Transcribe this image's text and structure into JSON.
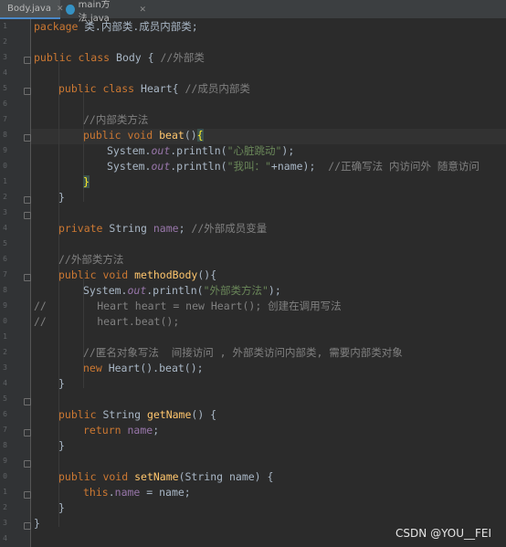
{
  "tabs": [
    {
      "label": "Body.java",
      "active": true,
      "icon": "java-class-icon"
    },
    {
      "label": "main方法.java",
      "active": false,
      "icon": "java-class-icon"
    }
  ],
  "gutter": {
    "numbers": [
      "1",
      "2",
      "3",
      "4",
      "5",
      "6",
      "7",
      "8",
      "9",
      "0",
      "1",
      "2",
      "3",
      "4",
      "5",
      "6",
      "7",
      "8",
      "9",
      "0",
      "1",
      "2",
      "3",
      "4",
      "5",
      "6",
      "7",
      "8",
      "9",
      "0",
      "1",
      "2",
      "3",
      "4"
    ]
  },
  "code": {
    "package_kw": "package",
    "package_name": " 类.内部类.成员内部类;",
    "l3": {
      "kw": "public class",
      "rest": " Body { ",
      "cm": "//外部类"
    },
    "l5": {
      "kw": "public class",
      "rest": " Heart{ ",
      "cm": "//成员内部类"
    },
    "l7": {
      "cm": "//内部类方法"
    },
    "l8": {
      "kw": "public void",
      "sp": " ",
      "fn": "beat",
      "p1": "()",
      "brace": "{"
    },
    "l9": {
      "a": "System.",
      "f": "out",
      "b": ".println(",
      "s": "\"心脏跳动\"",
      "c": ");"
    },
    "l10": {
      "a": "System.",
      "f": "out",
      "b": ".println(",
      "s": "\"我叫：\"",
      "c": "+name);  ",
      "cm": "//正确写法 内访问外 随意访问"
    },
    "l11": {
      "brace": "}"
    },
    "l12": {
      "brace": "}"
    },
    "l14": {
      "kw": "private",
      "rest": " String ",
      "fld": "name",
      "semi": "; ",
      "cm": "//外部成员变量"
    },
    "l16": {
      "cm": "//外部类方法"
    },
    "l17": {
      "kw": "public void",
      "sp": " ",
      "fn": "methodBody",
      "p1": "(){"
    },
    "l18": {
      "a": "System.",
      "f": "out",
      "b": ".println(",
      "s": "\"外部类方法\"",
      "c": ");"
    },
    "l19": {
      "cm": "//        Heart heart = new Heart(); 创建在调用写法"
    },
    "l20": {
      "cm": "//        heart.beat();"
    },
    "l22": {
      "cm": "//匿名对象写法  间接访问 , 外部类访问内部类, 需要内部类对象"
    },
    "l23": {
      "kw": "new",
      "rest": " Heart().beat();"
    },
    "l24": {
      "brace": "}"
    },
    "l26": {
      "kw": "public",
      "rest": " String ",
      "fn": "getName",
      "p1": "() {"
    },
    "l27": {
      "kw": "return",
      "sp": " ",
      "fld": "name",
      "semi": ";"
    },
    "l28": {
      "brace": "}"
    },
    "l30": {
      "kw": "public void",
      "sp": " ",
      "fn": "setName",
      "p1": "(String name) {"
    },
    "l31": {
      "kw": "this",
      "dot": ".",
      "fld": "name",
      "rest": " = name;"
    },
    "l32": {
      "brace": "}"
    },
    "l33": {
      "brace": "}"
    }
  },
  "watermark": "CSDN @YOU__FEI"
}
